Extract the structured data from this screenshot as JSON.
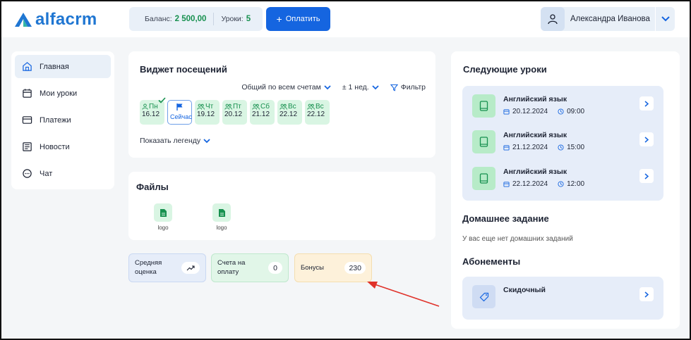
{
  "app": {
    "logo_text": "alfacrm"
  },
  "header": {
    "balance_label": "Баланс:",
    "balance_value": "2 500,00",
    "lessons_label": "Уроки:",
    "lessons_value": "5",
    "pay_button": "Оплатить",
    "user_name": "Александра Иванова"
  },
  "sidebar": {
    "items": [
      {
        "label": "Главная",
        "icon": "home-icon",
        "active": true
      },
      {
        "label": "Мои уроки",
        "icon": "calendar-icon"
      },
      {
        "label": "Платежи",
        "icon": "card-icon"
      },
      {
        "label": "Новости",
        "icon": "news-icon"
      },
      {
        "label": "Чат",
        "icon": "chat-icon"
      }
    ]
  },
  "visits": {
    "title": "Виджет посещений",
    "account_filter": "Общий по всем счетам",
    "period": "± 1 нед.",
    "filter": "Фильтр",
    "days": [
      {
        "wd": "Пн",
        "date": "16.12"
      },
      {
        "wd": "Сейчас",
        "date": ""
      },
      {
        "wd": "Чт",
        "date": "19.12"
      },
      {
        "wd": "Пт",
        "date": "20.12"
      },
      {
        "wd": "Сб",
        "date": "21.12"
      },
      {
        "wd": "Вс",
        "date": "22.12"
      },
      {
        "wd": "Вс",
        "date": "22.12"
      }
    ],
    "legend": "Показать легенду"
  },
  "files": {
    "title": "Файлы",
    "items": [
      "logo",
      "logo"
    ]
  },
  "stats": {
    "avg_label": "Средняя оценка",
    "invoices_label": "Счета на оплату",
    "invoices_value": "0",
    "bonus_label": "Бонусы",
    "bonus_value": "230"
  },
  "next_lessons": {
    "title": "Следующие уроки",
    "items": [
      {
        "name": "Английский язык",
        "date": "20.12.2024",
        "time": "09:00"
      },
      {
        "name": "Английский язык",
        "date": "21.12.2024",
        "time": "15:00"
      },
      {
        "name": "Английский язык",
        "date": "22.12.2024",
        "time": "12:00"
      }
    ]
  },
  "homework": {
    "title": "Домашнее задание",
    "empty": "У вас еще нет домашних заданий"
  },
  "subscriptions": {
    "title": "Абонементы",
    "items": [
      {
        "name": "Скидочный"
      }
    ]
  },
  "colors": {
    "brand": "#1565e0",
    "green": "#17904f",
    "arrow": "#e0322a"
  }
}
